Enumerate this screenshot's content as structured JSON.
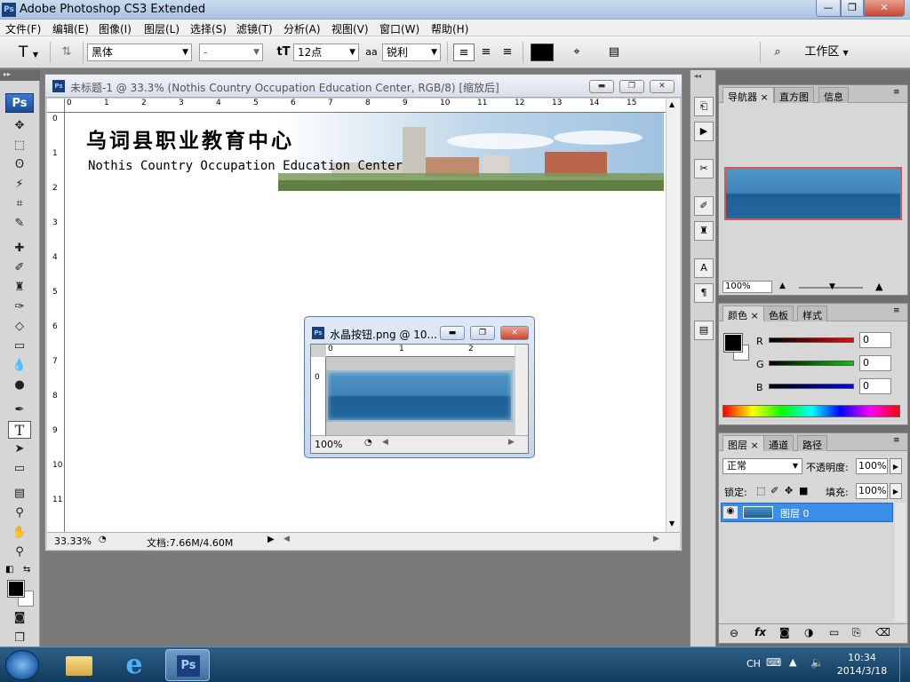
{
  "window": {
    "title": "Adobe Photoshop CS3 Extended",
    "app_badge": "Ps",
    "controls": {
      "minimize": "—",
      "maximize": "❐",
      "close": "✕"
    }
  },
  "menu": [
    "文件(F)",
    "编辑(E)",
    "图像(I)",
    "图层(L)",
    "选择(S)",
    "滤镜(T)",
    "分析(A)",
    "视图(V)",
    "窗口(W)",
    "帮助(H)"
  ],
  "options": {
    "tool_icon": "T",
    "font_family": "黑体",
    "font_style": "-",
    "font_size": "12点",
    "antialias_icon": "aa",
    "antialias": "锐利",
    "color": "#000000",
    "workspace": "工作区"
  },
  "tools": {
    "panel_logo": "Ps",
    "selected": "type-tool"
  },
  "document": {
    "title": "未标题-1 @ 33.3% (Nothis Country Occupation Education Center, RGB/8) [缩放后]",
    "ruler_h": [
      "0",
      "1",
      "2",
      "3",
      "4",
      "5",
      "6",
      "7",
      "8",
      "9",
      "10",
      "11",
      "12",
      "13",
      "14",
      "15"
    ],
    "ruler_v": [
      "0",
      "1",
      "2",
      "3",
      "4",
      "5",
      "6",
      "7",
      "8",
      "9",
      "10",
      "11"
    ],
    "banner_cn": "乌词县职业教育中心",
    "banner_en": "Nothis Country Occupation Education Center",
    "zoom": "33.33%",
    "doc_info": "文档:7.66M/4.60M"
  },
  "small_doc": {
    "title": "水晶按钮.png @ 10...",
    "ruler_h": [
      "0",
      "1",
      "2"
    ],
    "ruler_v": [
      "0"
    ],
    "zoom": "100%"
  },
  "navigator": {
    "tabs": [
      "导航器",
      "直方图",
      "信息"
    ],
    "zoom": "100%"
  },
  "color_panel": {
    "tabs": [
      "颜色",
      "色板",
      "样式"
    ],
    "r_label": "R",
    "g_label": "G",
    "b_label": "B",
    "r": "0",
    "g": "0",
    "b": "0"
  },
  "layers_panel": {
    "tabs": [
      "图层",
      "通道",
      "路径"
    ],
    "blend_mode": "正常",
    "opacity_label": "不透明度:",
    "opacity": "100%",
    "lock_label": "锁定:",
    "fill_label": "填充:",
    "fill": "100%",
    "layer_name": "图层 0"
  },
  "taskbar": {
    "ime": "CH",
    "time": "10:34",
    "date": "2014/3/18"
  }
}
